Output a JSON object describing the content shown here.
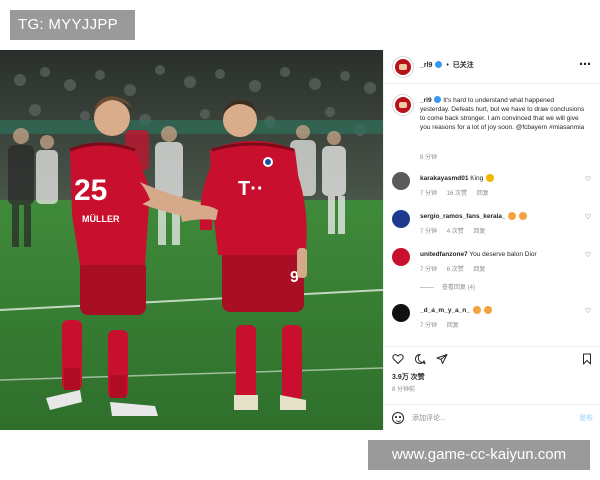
{
  "tag_banner": "TG: MYYJJPP",
  "url_banner": "www.game-cc-kaiyun.com",
  "post": {
    "username": "_rl9",
    "follow_label": "已关注",
    "caption_user": "_rl9",
    "caption": "It's hard to understand what happened yesterday. Defeats hurt, but we have to draw conclusions to come back stronger. I am convinced that we will give you reasons for a lot of joy soon. @fcbayern #miasanmia",
    "caption_time": "8 分钟",
    "jersey_numbers": {
      "left": "25",
      "right": "9"
    },
    "jersey_names": {
      "left": "MÜLLER"
    },
    "comments": [
      {
        "user": "karakayasmd01",
        "text": "King",
        "time": "7 分钟",
        "likes": "16 次赞",
        "reply": "回复",
        "avatar_color": "#5a5a5a"
      },
      {
        "user": "sergio_ramos_fans_kerala_",
        "text": "",
        "time": "7 分钟",
        "likes": "4 次赞",
        "reply": "回复",
        "avatar_color": "#1d3a8f"
      },
      {
        "user": "unitedfanzone7",
        "text": "You deserve balon Dior",
        "time": "7 分钟",
        "likes": "6 次赞",
        "reply": "回复",
        "avatar_color": "#c8102e",
        "view_replies": "查看回复 (4)"
      },
      {
        "user": "_d_a_m_y_a_n_",
        "text": "",
        "time": "7 分钟",
        "likes": "",
        "reply": "回复",
        "avatar_color": "#111111"
      }
    ],
    "likes_count": "3.9万 次赞",
    "time_ago": "8 分钟前",
    "add_comment_placeholder": "添加评论...",
    "post_button": "发布"
  },
  "colors": {
    "accent_blue": "#3897f0",
    "jersey_red": "#c8102e",
    "pitch_green": "#2f7a2f"
  }
}
